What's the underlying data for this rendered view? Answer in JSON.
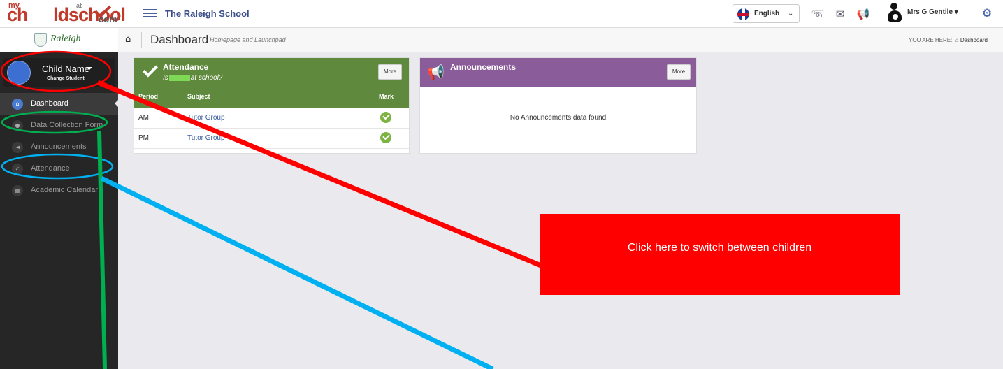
{
  "header": {
    "logo": {
      "my": "my",
      "ch": "ch",
      "school": "ldschool",
      "at": "at",
      "com": "com"
    },
    "school_name": "The Raleigh School",
    "language": "English",
    "user_name": "Mrs G Gentile ▾"
  },
  "sidebar": {
    "school_logo_text": "Raleigh",
    "child_name": "Child Name",
    "change_student": "Change Student",
    "items": [
      {
        "label": "Dashboard",
        "icon": "home-icon"
      },
      {
        "label": "Data Collection Form",
        "icon": "user-icon"
      },
      {
        "label": "Announcements",
        "icon": "megaphone-icon"
      },
      {
        "label": "Attendance",
        "icon": "check-icon"
      },
      {
        "label": "Academic Calendar",
        "icon": "calendar-icon"
      }
    ]
  },
  "page_header": {
    "title": "Dashboard",
    "subtitle": "Homepage and Launchpad",
    "you_are_here": "YOU ARE HERE:",
    "breadcrumb": "Dashboard"
  },
  "attendance": {
    "title": "Attendance",
    "question_prefix": "Is",
    "question_suffix": "at school?",
    "more": "More",
    "columns": [
      "Period",
      "Subject",
      "Mark"
    ],
    "rows": [
      {
        "period": "AM",
        "subject": "Tutor Group"
      },
      {
        "period": "PM",
        "subject": "Tutor Group"
      }
    ]
  },
  "announcements": {
    "title": "Announcements",
    "more": "More",
    "empty": "No Announcements data found"
  },
  "annotation": {
    "callout": "Click here to switch between children",
    "colors": {
      "red": "#ff0000",
      "green": "#00b050",
      "blue": "#00b0f0"
    }
  }
}
